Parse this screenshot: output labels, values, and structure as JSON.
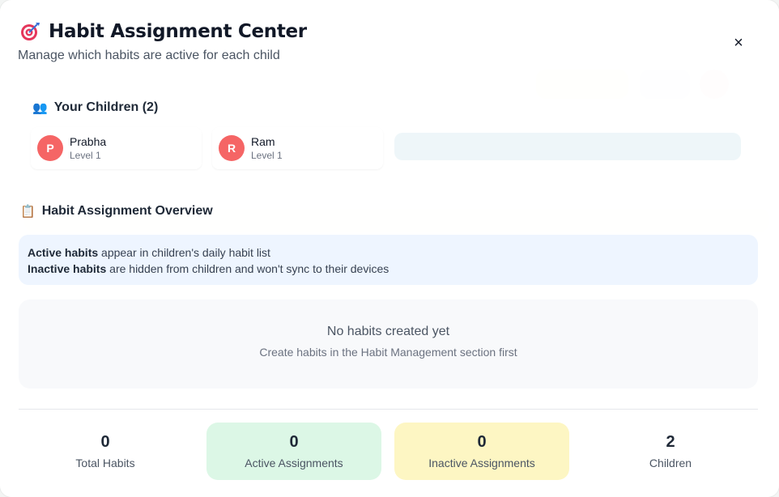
{
  "modal": {
    "title": "Habit Assignment Center",
    "subtitle": "Manage which habits are active for each child",
    "close_label": "×"
  },
  "children_section": {
    "icon": "👥",
    "heading": "Your Children (2)",
    "children": [
      {
        "initial": "P",
        "name": "Prabha",
        "level": "Level 1"
      },
      {
        "initial": "R",
        "name": "Ram",
        "level": "Level 1"
      }
    ]
  },
  "overview_section": {
    "icon": "📋",
    "heading": "Habit Assignment Overview",
    "info_active_bold": "Active habits",
    "info_active_rest": " appear in children's daily habit list",
    "info_inactive_bold": "Inactive habits",
    "info_inactive_rest": " are hidden from children and won't sync to their devices",
    "empty_title": "No habits created yet",
    "empty_sub": "Create habits in the Habit Management section first"
  },
  "stats": [
    {
      "value": "0",
      "label": "Total Habits"
    },
    {
      "value": "0",
      "label": "Active Assignments"
    },
    {
      "value": "0",
      "label": "Inactive Assignments"
    },
    {
      "value": "2",
      "label": "Children"
    }
  ],
  "colors": {
    "avatar": "#f56565",
    "active_bg": "#dcf7e6",
    "inactive_bg": "#fdf6c3",
    "info_bg": "#eef5ff"
  }
}
